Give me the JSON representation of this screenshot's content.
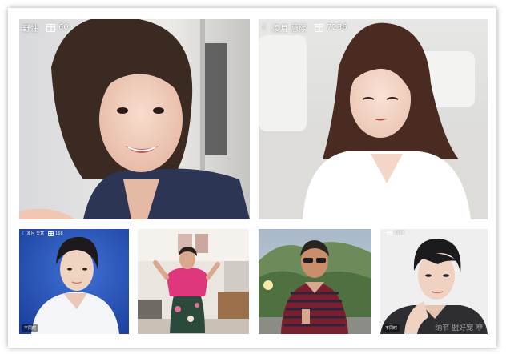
{
  "cards": [
    {
      "name": "野性",
      "count": "60"
    },
    {
      "name": "凌月 慧熙",
      "count": "7236"
    },
    {
      "name": "凌月 天意",
      "count": "168",
      "badge": "不同时"
    },
    {
      "name": "",
      "count": ""
    },
    {
      "name": "",
      "count": ""
    },
    {
      "name": "",
      "count": "1334",
      "badge": "不同时"
    }
  ],
  "icons": {
    "gift": "gift-icon",
    "moon": "moon-icon"
  },
  "watermark": "纳节 盟好宠 咿"
}
